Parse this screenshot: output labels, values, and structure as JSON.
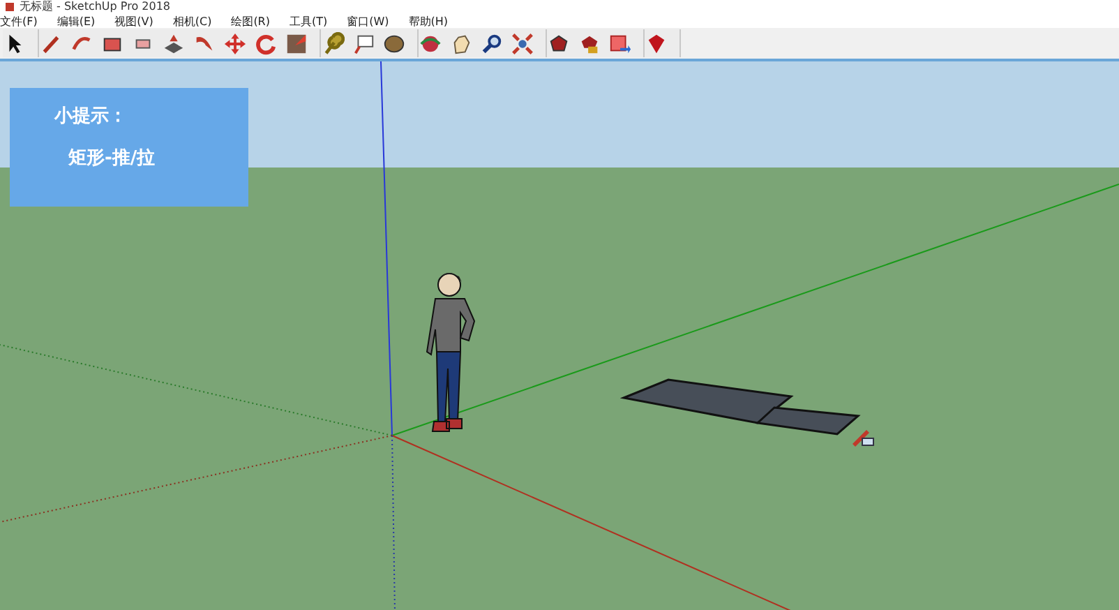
{
  "window": {
    "title": "无标题 - SketchUp Pro 2018"
  },
  "menu": [
    {
      "label": "文件(F)"
    },
    {
      "label": "编辑(E)"
    },
    {
      "label": "视图(V)"
    },
    {
      "label": "相机(C)"
    },
    {
      "label": "绘图(R)"
    },
    {
      "label": "工具(T)"
    },
    {
      "label": "窗口(W)"
    },
    {
      "label": "帮助(H)"
    }
  ],
  "tip": {
    "title": "小提示：",
    "text": "矩形-推/拉"
  }
}
